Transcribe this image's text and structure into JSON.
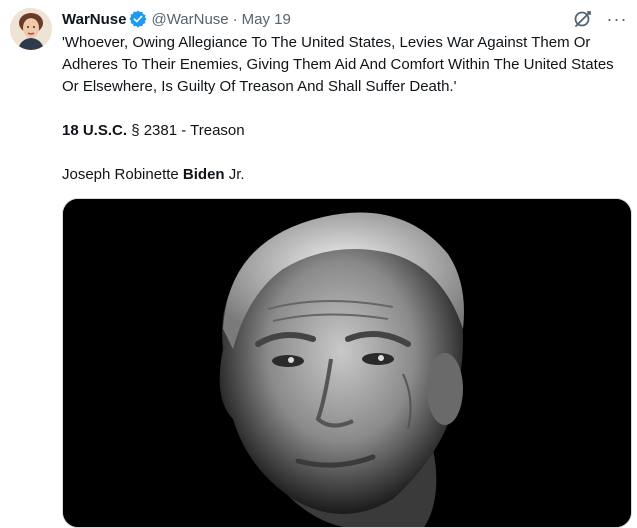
{
  "tweet": {
    "author": {
      "display_name": "WarNuse",
      "handle": "@WarNuse",
      "verified": true
    },
    "separator": "·",
    "date": "May 19",
    "icons": {
      "verified": "verified-badge-icon",
      "grok": "grok-icon",
      "more": "more-icon"
    },
    "more_glyph": "···",
    "text": {
      "quote": "'Whoever, Owing Allegiance To The United States, Levies War Against Them Or Adheres To Their Enemies, Giving Them Aid And Comfort Within The United States Or Elsewhere, Is Guilty Of Treason And Shall Suffer Death.'",
      "citation_bold": "18 U.S.C.",
      "citation_rest": " § 2381 - Treason",
      "name_first": "Joseph Robinette ",
      "name_bold": "Biden",
      "name_last": " Jr."
    }
  },
  "colors": {
    "text": "#0f1419",
    "secondary": "#536471",
    "verified": "#1d9bf0",
    "media_bg": "#000000"
  }
}
